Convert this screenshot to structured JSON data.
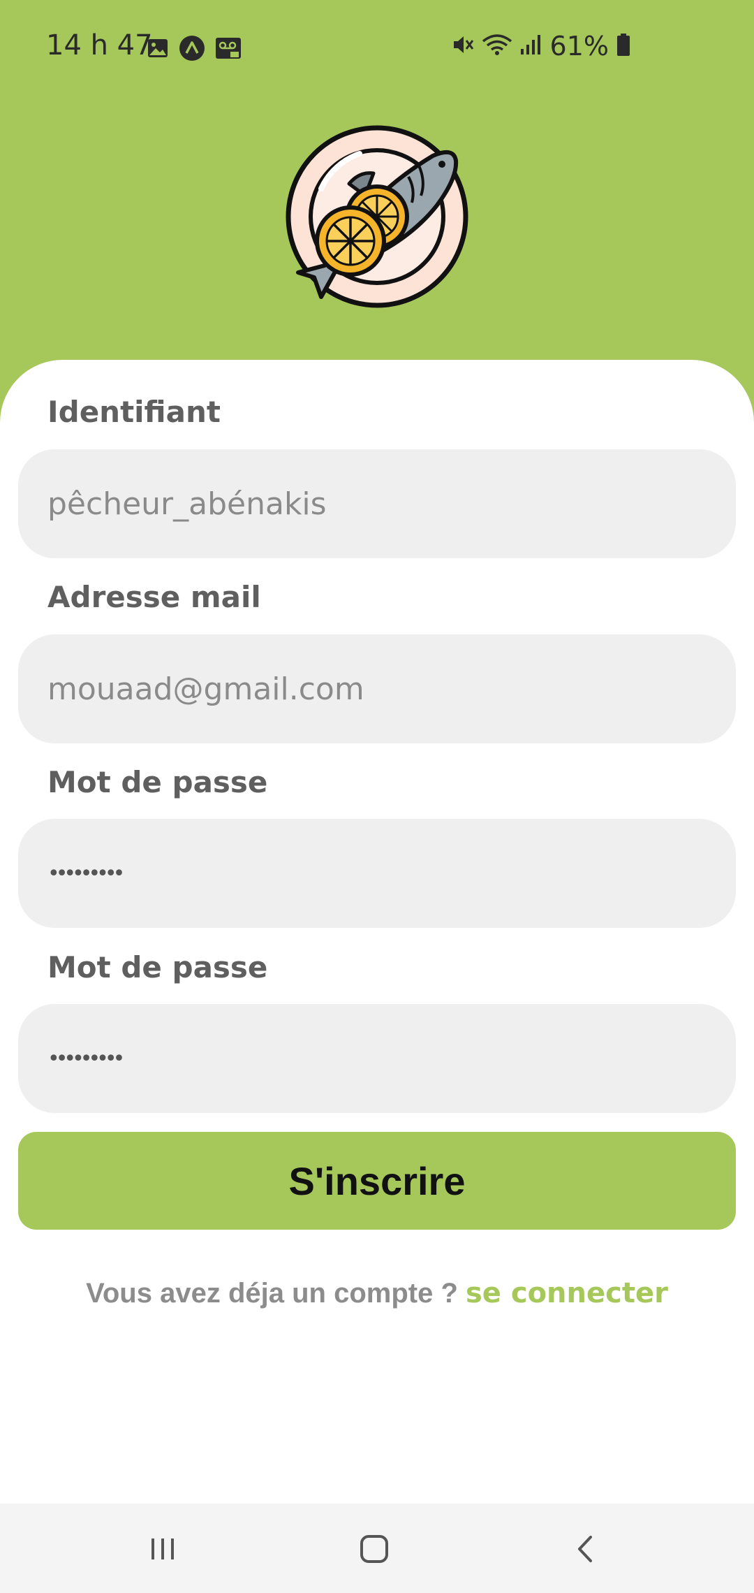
{
  "status_bar": {
    "time": "14 h 47",
    "battery_percent": "61%",
    "left_icons": [
      "gallery-icon",
      "app-notification-icon",
      "voicemail-icon"
    ],
    "right_icons": [
      "mute-icon",
      "wifi-icon",
      "signal-icon",
      "battery-icon"
    ]
  },
  "colors": {
    "brand_green": "#a6c85a",
    "field_bg": "#efefef"
  },
  "logo": {
    "icon": "fish-plate-lemon-icon"
  },
  "form": {
    "username_label": "Identifiant",
    "username_placeholder": "pêcheur_abénakis",
    "email_label": "Adresse mail",
    "email_placeholder": "mouaad@gmail.com",
    "password_label": "Mot de passe",
    "password_value": "•••••••••",
    "confirm_label": "Mot de passe",
    "confirm_value": "•••••••••",
    "submit_label": "S'inscrire"
  },
  "footer": {
    "question": "Vous avez déja un compte ?",
    "link": "se connecter"
  },
  "nav_bar": {
    "icons": [
      "recent-apps-icon",
      "home-icon",
      "back-icon"
    ]
  }
}
